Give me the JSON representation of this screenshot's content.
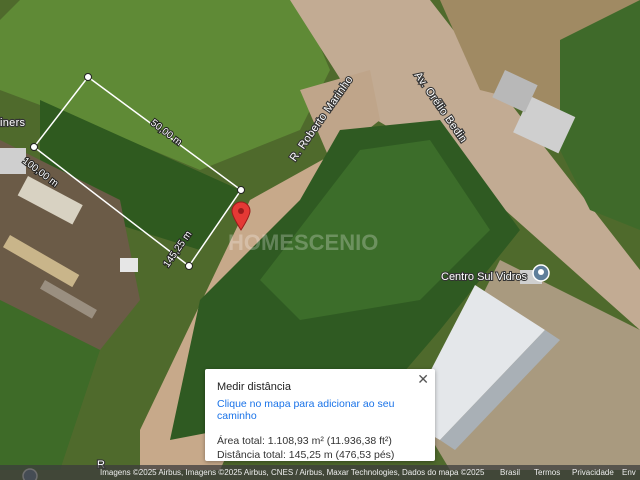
{
  "map": {
    "streets": {
      "roberto_marinho": "R. Roberto Marinho",
      "orelio_bedin": "Av. Orélio Bedin",
      "partial_bottom": "R"
    },
    "partial_left_label": "iners",
    "poi": {
      "name": "Centro Sul Vidros",
      "icon": "place-pin-icon"
    },
    "measure": {
      "segments": {
        "top": "50,00 m",
        "left": "100,00 m",
        "bottom": "145,25 m"
      },
      "color": "#ffffff"
    },
    "marker": {
      "icon": "red-map-pin-icon",
      "color": "#e53935"
    },
    "watermark": "HOMESCENIO"
  },
  "panel": {
    "title": "Medir distância",
    "hint": "Clique no mapa para adicionar ao seu caminho",
    "area": "Área total: 1.108,93 m² (11.936,38 ft²)",
    "distance": "Distância total: 145,25 m (476,53 pés)",
    "close_icon": "close-icon"
  },
  "footer": {
    "attribution": "Imagens ©2025 Airbus, Imagens ©2025 Airbus, CNES / Airbus, Maxar Technologies, Dados do mapa ©2025",
    "links": [
      "Brasil",
      "Termos",
      "Privacidade",
      "Env"
    ]
  }
}
